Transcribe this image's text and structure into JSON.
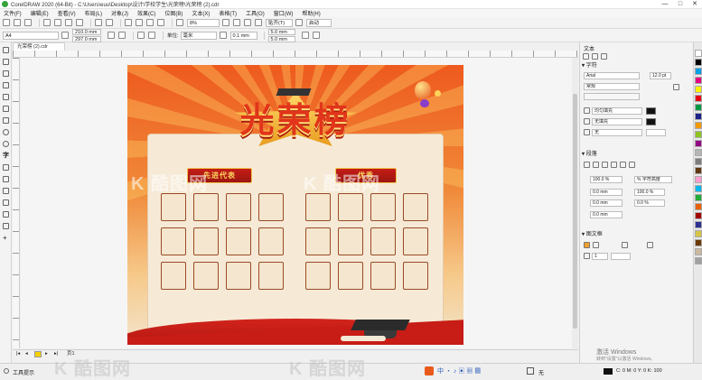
{
  "window": {
    "title": "CorelDRAW 2020 (64-Bit) - C:\\Users\\euu\\Desktop\\设计\\学校学生\\光荣榜\\光荣榜 (2).cdr",
    "controls": [
      "—",
      "□",
      "✕"
    ]
  },
  "menu": [
    "文件(F)",
    "编辑(E)",
    "查看(V)",
    "布局(L)",
    "对象(J)",
    "效果(C)",
    "位图(B)",
    "文本(X)",
    "表格(T)",
    "工具(O)",
    "窗口(W)",
    "帮助(H)"
  ],
  "standard_toolbar": {
    "zoom": "8%",
    "snap_label": "贴齐(T)",
    "launch_label": "启动"
  },
  "property_bar": {
    "page_size": "A4",
    "width": "210.0 mm",
    "height": "297.0 mm",
    "units_label": "单位:",
    "units": "毫米",
    "nudge": "0.1 mm",
    "dup_x": "5.0 mm",
    "dup_y": "5.0 mm"
  },
  "doc_tab": "光荣榜 (2).cdr",
  "artboard": {
    "headline": "光荣榜",
    "group1": "先进代表",
    "group2": "优秀"
  },
  "docker": {
    "title": "文本",
    "char_section": "字符",
    "font": "Arial",
    "font_size": "12.0 pt",
    "font_style": "常规",
    "fill1": "均匀填充",
    "fill2": "无填充",
    "fill3": "无",
    "para_section": "段落",
    "line_spacing": "100.0 %",
    "spacing_mode": "% 字符高度",
    "before_para": "0.0 mm",
    "char_spacing": "100.0 %",
    "after_para": "0.0 mm",
    "word_spacing": "0.0 %",
    "indent": "0.0 mm",
    "frame_section": "图文框",
    "columns": "1"
  },
  "page_bar": {
    "page": "页1"
  },
  "status": {
    "left": "工具提示",
    "fill": "无",
    "coords": "C: 0   M: 0   Y: 0   K: 100",
    "activate": "激活 Windows",
    "activate_sub": "转到\"设置\"以激活 Windows。"
  },
  "watermark": "K 酷图网",
  "colors": {
    "accent_red": "#c41e16",
    "gold": "#f2c24a",
    "panel": "#f6ead7"
  },
  "palette": [
    "#ffffff",
    "#000000",
    "#00a0e9",
    "#e4007f",
    "#fff100",
    "#e60012",
    "#009944",
    "#1d2088",
    "#f39800",
    "#8fc31f",
    "#920783",
    "#b5b5b5",
    "#7d7d7d",
    "#603813",
    "#ff9ecf",
    "#00b7ee",
    "#22ac38",
    "#eb6100",
    "#a40000",
    "#2e3192",
    "#d7c447",
    "#6a3906",
    "#ccb8a0",
    "#9fa0a0"
  ]
}
